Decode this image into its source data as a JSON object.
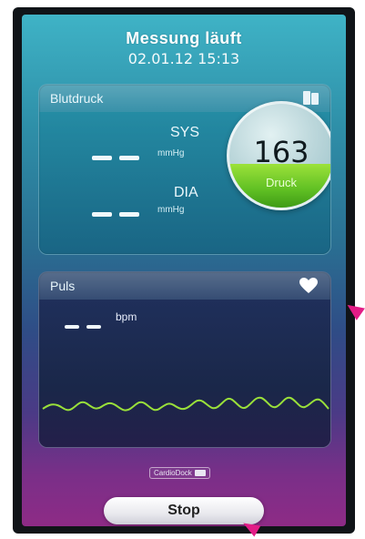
{
  "header": {
    "title": "Messung läuft",
    "timestamp": "02.01.12 15:13"
  },
  "blood_pressure": {
    "title": "Blutdruck",
    "sys": {
      "label": "SYS",
      "value": "– –",
      "unit": "mmHg"
    },
    "dia": {
      "label": "DIA",
      "value": "– –",
      "unit": "mmHg"
    },
    "gauge": {
      "value": "163",
      "label": "Druck",
      "fill_fraction": 0.42,
      "fill_color": "#7fd12e"
    }
  },
  "pulse": {
    "title": "Puls",
    "value": "– –",
    "unit": "bpm"
  },
  "footer": {
    "badge_label": "CardioDock"
  },
  "actions": {
    "stop_label": "Stop"
  },
  "colors": {
    "accent": "#7fd12e",
    "annotation": "#e21c86"
  },
  "icons": {
    "blood_pressure": "book-icon",
    "pulse": "heart-icon"
  }
}
